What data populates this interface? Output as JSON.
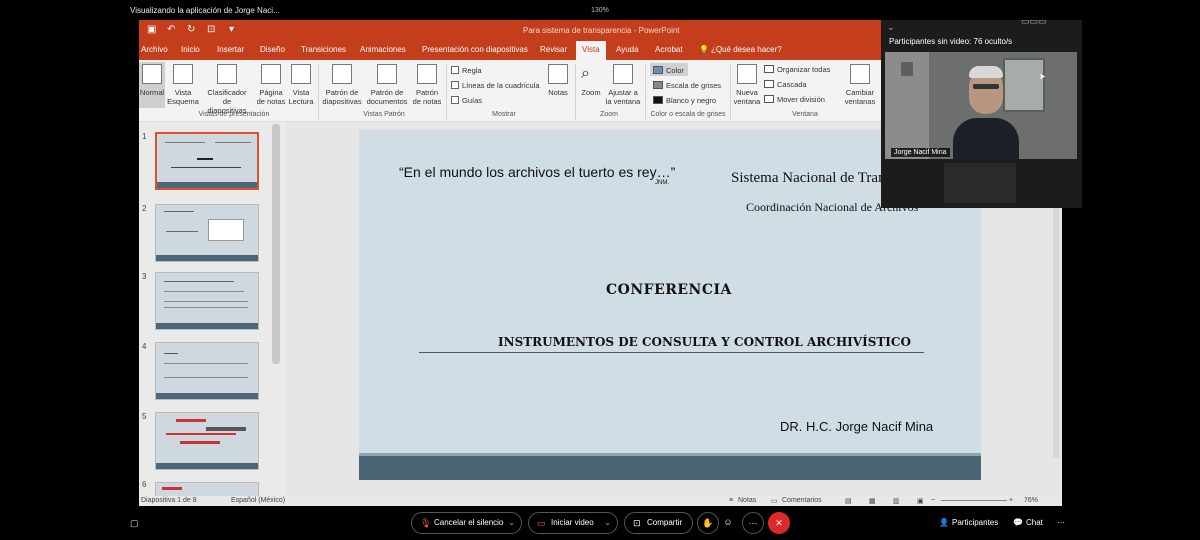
{
  "viewer": {
    "title": "Visualizando la aplicación de Jorge Naci...",
    "zoom_pct": "130%"
  },
  "ppt": {
    "window_title": "Para sistema de transparencia  -  PowerPoint",
    "tabs": [
      "Archivo",
      "Inicio",
      "Insertar",
      "Diseño",
      "Transiciones",
      "Animaciones",
      "Presentación con diapositivas",
      "Revisar",
      "Vista",
      "Ayuda",
      "Acrobat"
    ],
    "active_tab": "Vista",
    "tell_me": "¿Qué desea hacer?",
    "ribbon": {
      "normal": "Normal",
      "vista_esquema": "Vista Esquema",
      "clasificador": "Clasificador de diapositivas",
      "pagina_notas": "Página de notas",
      "vista_lectura": "Vista Lectura",
      "group_vistas": "Vistas de presentación",
      "patron_diapositivas": "Patrón de diapositivas",
      "patron_documentos": "Patrón de documentos",
      "patron_notas": "Patrón de notas",
      "group_patron": "Vistas Patrón",
      "regla": "Regla",
      "lineas": "Líneas de la cuadrícula",
      "guias": "Guías",
      "notas": "Notas",
      "group_mostrar": "Mostrar",
      "zoom": "Zoom",
      "ajustar": "Ajustar a la ventana",
      "group_zoom": "Zoom",
      "color": "Color",
      "escala_grises": "Escala de grises",
      "blanco_negro": "Blanco y negro",
      "group_color": "Color o escala de grises",
      "nueva_ventana": "Nueva ventana",
      "organizar": "Organizar todas",
      "cascada": "Cascada",
      "mover_division": "Mover división",
      "group_ventana": "Ventana",
      "cambiar_ventanas": "Cambiar ventanas"
    },
    "thumb_numbers": [
      "1",
      "2",
      "3",
      "4",
      "5",
      "6"
    ],
    "slide": {
      "quote": "“En el mundo los archivos el tuerto es rey…”",
      "quote_sig": "JNM.",
      "org": "Sistema Nacional de Tran",
      "coord": "Coordinación Nacional de Archivos",
      "title": "CONFERENCIA",
      "subtitle": "INSTRUMENTOS DE CONSULTA Y CONTROL ARCHIVÍSTICO",
      "author": "DR. H.C. Jorge Nacif Mina"
    },
    "status": {
      "slide_of": "Diapositiva 1 de 8",
      "language": "Español (México)",
      "notes": "Notas",
      "comments": "Comentarios",
      "zoom": "76%"
    }
  },
  "video_panel": {
    "header": "Participantes sin video:  76 oculto/s",
    "participant_name": "Jorge Nacif Mina"
  },
  "meeting_bar": {
    "mute": "Cancelar el silencio",
    "video": "Iniciar video",
    "share": "Compartir",
    "more": "···",
    "participants": "Participantes",
    "chat": "Chat",
    "overflow": "···"
  },
  "colors": {
    "ppt_accent": "#c43e1c",
    "slide_bg": "#d1dde4",
    "slide_band": "#4a6676",
    "end_button": "#e02828"
  }
}
